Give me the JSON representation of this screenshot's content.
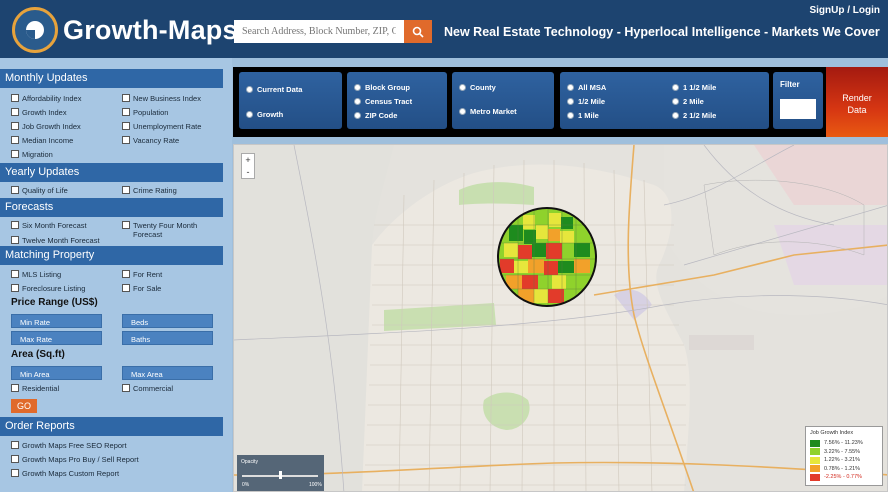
{
  "header": {
    "brand": "Growth-Maps",
    "search_placeholder": "Search Address, Block Number, ZIP, City",
    "tagline": "New Real Estate Technology - Hyperlocal Intelligence - Markets We Cover",
    "signup": "SignUp / Login"
  },
  "sidebar": {
    "monthly": {
      "title": "Monthly Updates",
      "items": [
        "Affordability Index",
        "New Business Index",
        "Growth Index",
        "Population",
        "Job Growth Index",
        "Unemployment Rate",
        "Median Income",
        "Vacancy Rate",
        "Migration"
      ]
    },
    "yearly": {
      "title": "Yearly Updates",
      "items": [
        "Quality of Life",
        "Crime Rating"
      ]
    },
    "forecasts": {
      "title": "Forecasts",
      "items": [
        "Six Month Forecast",
        "Twenty Four Month Forecast",
        "Twelve Month Forecast"
      ]
    },
    "matching": {
      "title": "Matching Property",
      "items": [
        "MLS Listing",
        "For Rent",
        "Foreclosure Listing",
        "For Sale"
      ],
      "price_label": "Price Range (US$)",
      "price_fields": [
        "Min Rate",
        "Beds",
        "Max Rate",
        "Baths"
      ],
      "area_label": "Area (Sq.ft)",
      "area_fields": [
        "Min Area",
        "Max Area"
      ],
      "type_items": [
        "Residential",
        "Commercial"
      ],
      "go": "GO"
    },
    "reports": {
      "title": "Order Reports",
      "items": [
        "Growth Maps Free SEO Report",
        "Growth Maps Pro Buy / Sell Report",
        "Growth Maps Custom Report"
      ]
    }
  },
  "toolbar": {
    "group1": [
      "Current Data",
      "Growth"
    ],
    "group2": [
      "Block Group",
      "Census Tract",
      "ZIP Code"
    ],
    "group3": [
      "County",
      "Metro Market"
    ],
    "group4": [
      "All MSA",
      "1 1/2 Mile",
      "1/2 Mile",
      "2 Mile",
      "1 Mile",
      "2 1/2 Mile"
    ],
    "filter": "Filter",
    "render": [
      "Render",
      "Data"
    ]
  },
  "map": {
    "zoom_in": "+",
    "zoom_out": "-",
    "opacity_title": "Opacity",
    "opacity_value": 0.5,
    "opacity_min": "0%",
    "opacity_max": "100%",
    "legend": {
      "title": "Job Growth Index",
      "rows": [
        {
          "label": "7.56% - 11.23%",
          "color": "#1e8b1e"
        },
        {
          "label": "3.22% - 7.55%",
          "color": "#8fd22c"
        },
        {
          "label": "1.22% - 3.21%",
          "color": "#e6e63c"
        },
        {
          "label": "0.78% - 1.21%",
          "color": "#f2a12a"
        },
        {
          "label": "-2.25% - 0.77%",
          "color": "#e23b2a",
          "label_color": "#d2281c"
        }
      ]
    }
  }
}
